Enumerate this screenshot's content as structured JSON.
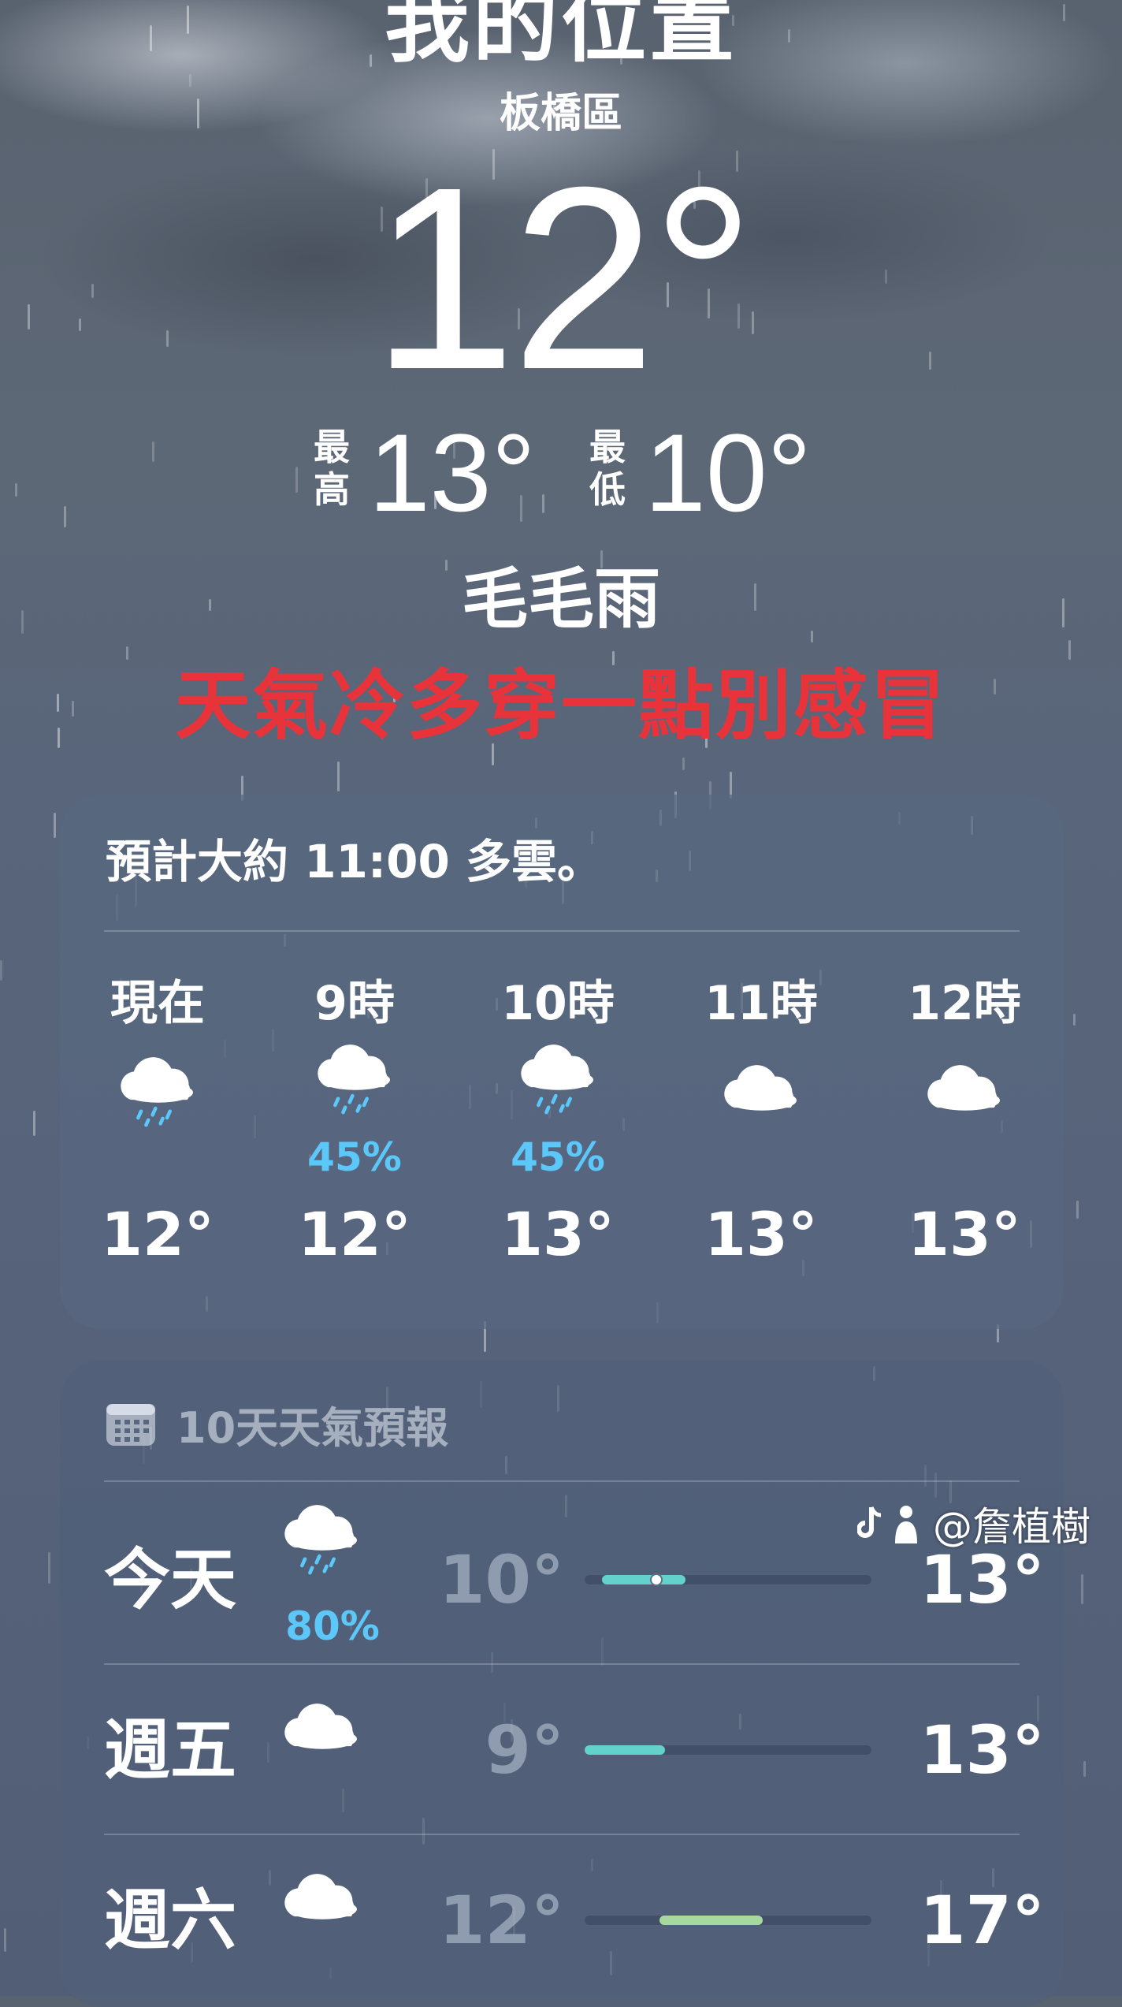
{
  "location": {
    "title": "我的位置",
    "district": "板橋區"
  },
  "current": {
    "temperature": "12°",
    "high_label": "最高",
    "high_value": "13°",
    "low_label": "最低",
    "low_value": "10°",
    "condition": "毛毛雨",
    "overlay_message": "天氣冷多穿一點別感冒"
  },
  "hourly": {
    "summary": "預計大約 11:00 多雲。",
    "items": [
      {
        "time": "現在",
        "icon": "cloud-drizzle-icon",
        "precip": "",
        "temp": "12°"
      },
      {
        "time": "9時",
        "icon": "cloud-drizzle-icon",
        "precip": "45%",
        "temp": "12°"
      },
      {
        "time": "10時",
        "icon": "cloud-drizzle-icon",
        "precip": "45%",
        "temp": "13°"
      },
      {
        "time": "11時",
        "icon": "cloud-icon",
        "precip": "",
        "temp": "13°"
      },
      {
        "time": "12時",
        "icon": "cloud-icon",
        "precip": "",
        "temp": "13°"
      }
    ]
  },
  "daily": {
    "title": "10天天氣預報",
    "items": [
      {
        "day": "今天",
        "icon": "cloud-drizzle-icon",
        "precip": "80%",
        "low": "10°",
        "high": "13°",
        "range_start": 0.06,
        "range_end": 0.35,
        "current_marker": 0.25
      },
      {
        "day": "週五",
        "icon": "cloud-icon",
        "precip": "",
        "low": "9°",
        "high": "13°",
        "range_start": 0.0,
        "range_end": 0.28
      },
      {
        "day": "週六",
        "icon": "cloud-icon",
        "precip": "",
        "low": "12°",
        "high": "17°",
        "range_start": 0.26,
        "range_end": 0.62
      }
    ]
  },
  "watermark": {
    "text": "@詹植樹"
  },
  "colors": {
    "precip": "#5cc8fa",
    "warning": "#e8333a",
    "bar_cool": "#63d2cc",
    "bar_mild": "#a6d8a0"
  }
}
